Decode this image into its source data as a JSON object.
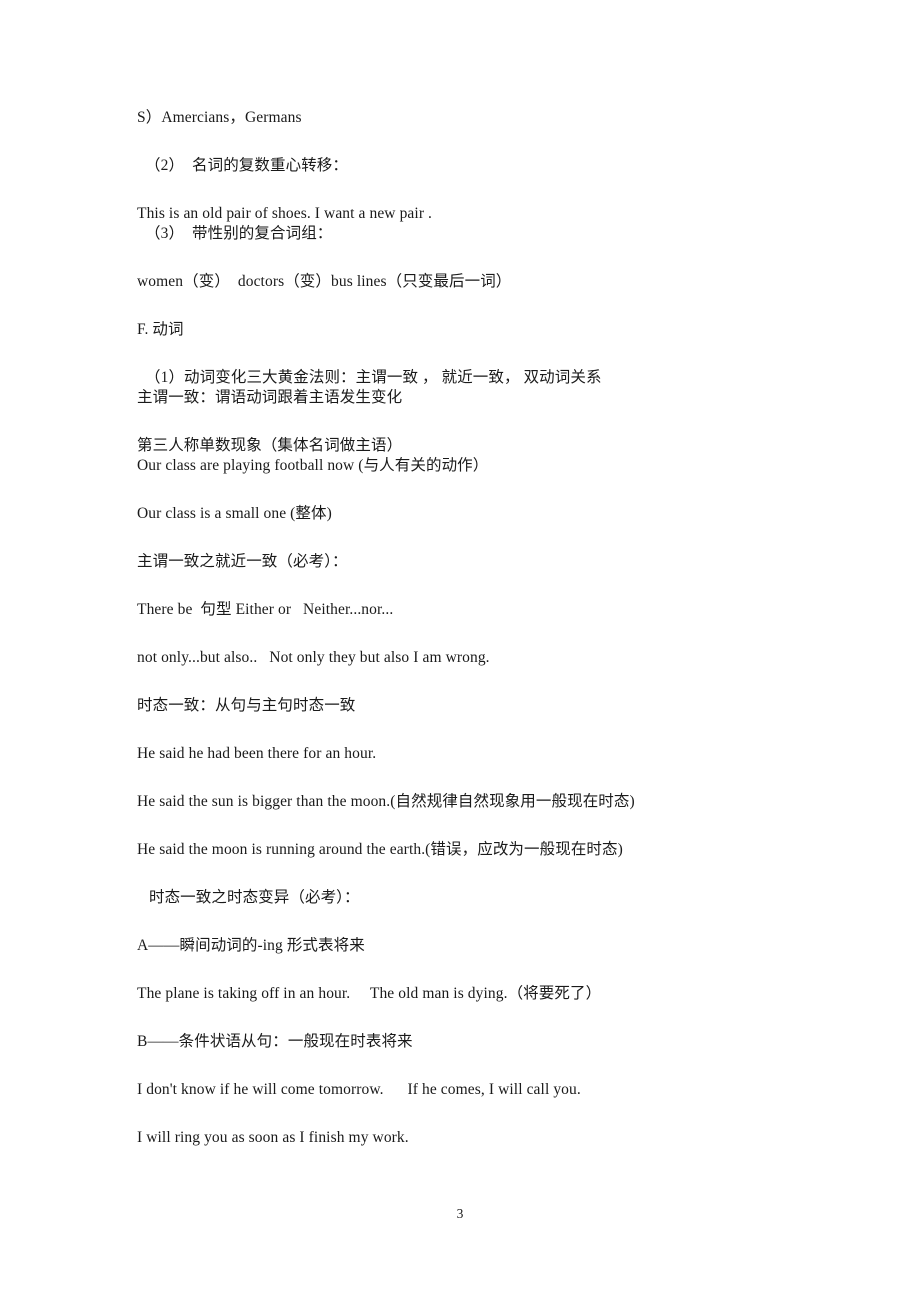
{
  "document": {
    "page_number": "3",
    "lines": [
      {
        "id": "l01",
        "text": "S）Amercians，Germans",
        "gap": "none",
        "indent": 0
      },
      {
        "id": "l02",
        "text": "（2）  名词的复数重心转移：",
        "gap": "lg",
        "indent": 1
      },
      {
        "id": "l03",
        "text": "This is an old pair of shoes. I want a new pair .",
        "gap": "lg",
        "indent": 0
      },
      {
        "id": "l04",
        "text": "（3）  带性别的复合词组：",
        "gap": "none",
        "indent": 1
      },
      {
        "id": "l05",
        "text": "women（变）  doctors（变）bus lines（只变最后一词）",
        "gap": "lg",
        "indent": 0
      },
      {
        "id": "l06",
        "text": "F. 动词",
        "gap": "lg",
        "indent": 0
      },
      {
        "id": "l07",
        "text": "（1）动词变化三大黄金法则：主谓一致 ， 就近一致， 双动词关系",
        "gap": "lg",
        "indent": 1
      },
      {
        "id": "l08",
        "text": "主谓一致：谓语动词跟着主语发生变化",
        "gap": "none",
        "indent": 0
      },
      {
        "id": "l09",
        "text": "第三人称单数现象（集体名词做主语）",
        "gap": "lg",
        "indent": 0
      },
      {
        "id": "l10",
        "text": "Our class are playing football now (与人有关的动作）",
        "gap": "none",
        "indent": 0
      },
      {
        "id": "l11",
        "text": "Our class is a small one (整体)",
        "gap": "lg",
        "indent": 0
      },
      {
        "id": "l12",
        "text": "主谓一致之就近一致（必考）：",
        "gap": "lg",
        "indent": 0
      },
      {
        "id": "l13",
        "text": "There be  句型 Either or   Neither...nor...",
        "gap": "lg",
        "indent": 0
      },
      {
        "id": "l14",
        "text": "not only...but also..   Not only they but also I am wrong.",
        "gap": "lg",
        "indent": 0
      },
      {
        "id": "l15",
        "text": "时态一致：从句与主句时态一致",
        "gap": "lg",
        "indent": 0
      },
      {
        "id": "l16",
        "text": "He said he had been there for an hour.",
        "gap": "lg",
        "indent": 0
      },
      {
        "id": "l17",
        "text": "He said the sun is bigger than the moon.(自然规律自然现象用一般现在时态)",
        "gap": "lg",
        "indent": 0
      },
      {
        "id": "l18",
        "text": "He said the moon is running around the earth.(错误，应改为一般现在时态)",
        "gap": "lg",
        "indent": 0
      },
      {
        "id": "l19",
        "text": " 时态一致之时态变异（必考）：",
        "gap": "lg",
        "indent": 1
      },
      {
        "id": "l20",
        "text": "A——瞬间动词的-ing 形式表将来",
        "gap": "lg",
        "indent": 0
      },
      {
        "id": "l21",
        "text": "The plane is taking off in an hour.     The old man is dying.（将要死了）",
        "gap": "lg",
        "indent": 0
      },
      {
        "id": "l22",
        "text": "B——条件状语从句：一般现在时表将来",
        "gap": "lg",
        "indent": 0
      },
      {
        "id": "l23",
        "text": "I don't know if he will come tomorrow.      If he comes, I will call you.",
        "gap": "lg",
        "indent": 0
      },
      {
        "id": "l24",
        "text": "I will ring you as soon as I finish my work.",
        "gap": "lg",
        "indent": 0
      }
    ]
  }
}
